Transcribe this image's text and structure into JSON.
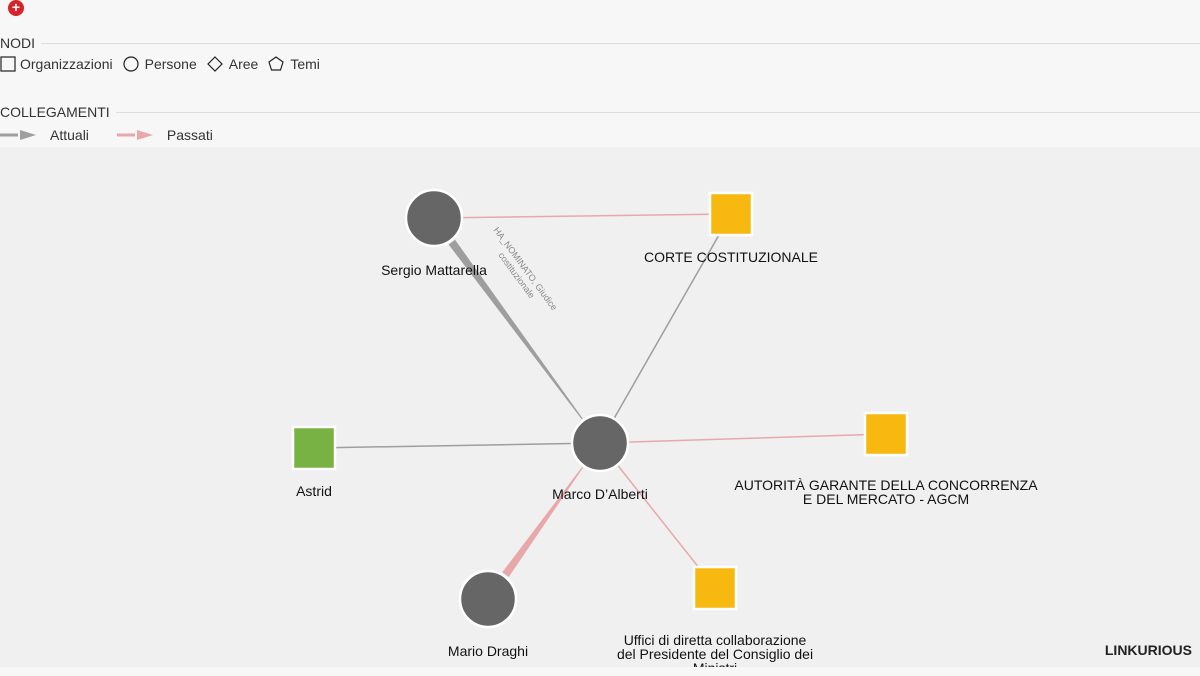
{
  "toolbar": {
    "add_icon": "plus-circle-icon",
    "add_glyph": "+"
  },
  "legend": {
    "nodes_title": "NODI",
    "node_types": [
      {
        "label": "Organizzazioni",
        "icon": "square-icon"
      },
      {
        "label": "Persone",
        "icon": "circle-icon"
      },
      {
        "label": "Aree",
        "icon": "diamond-icon"
      },
      {
        "label": "Temi",
        "icon": "pentagon-icon"
      }
    ],
    "links_title": "COLLEGAMENTI",
    "link_types": [
      {
        "label": "Attuali",
        "color": "#9e9e9e"
      },
      {
        "label": "Passati",
        "color": "#e8a8aa"
      }
    ]
  },
  "colors": {
    "person": "#666666",
    "org_yellow": "#f7b90f",
    "org_green": "#77b243",
    "current_edge": "#9e9e9e",
    "past_edge": "#e8a8aa"
  },
  "graph": {
    "nodes": [
      {
        "id": "mattarella",
        "shape": "circle",
        "color": "person",
        "label_lines": [
          "Sergio Mattarella"
        ]
      },
      {
        "id": "corte",
        "shape": "square",
        "color": "org_yellow",
        "label_lines": [
          "CORTE COSTITUZIONALE"
        ]
      },
      {
        "id": "astrid",
        "shape": "square",
        "color": "org_green",
        "label_lines": [
          "Astrid"
        ]
      },
      {
        "id": "dalberti",
        "shape": "circle",
        "color": "person",
        "label_lines": [
          "Marco D’Alberti"
        ]
      },
      {
        "id": "agcm",
        "shape": "square",
        "color": "org_yellow",
        "label_lines": [
          "AUTORITÀ GARANTE DELLA CONCORRENZA",
          "E DEL MERCATO - AGCM"
        ]
      },
      {
        "id": "draghi",
        "shape": "circle",
        "color": "person",
        "label_lines": [
          "Mario Draghi"
        ]
      },
      {
        "id": "uffici",
        "shape": "square",
        "color": "org_yellow",
        "label_lines": [
          "Uffici di diretta collaborazione",
          "del Presidente del Consiglio dei",
          "Ministri"
        ]
      }
    ],
    "edges": [
      {
        "from": "mattarella",
        "to": "corte",
        "type": "past"
      },
      {
        "from": "corte",
        "to": "dalberti",
        "type": "current"
      },
      {
        "from": "astrid",
        "to": "dalberti",
        "type": "current"
      },
      {
        "from": "dalberti",
        "to": "agcm",
        "type": "past"
      },
      {
        "from": "dalberti",
        "to": "uffici",
        "type": "past"
      },
      {
        "from": "mattarella",
        "to": "dalberti",
        "type": "current",
        "thick": true,
        "label_lines": [
          "HA_NOMINATO, Giudice",
          "costituzionale"
        ]
      },
      {
        "from": "draghi",
        "to": "dalberti",
        "type": "past",
        "thick": true
      }
    ]
  },
  "brand": {
    "logo_text": "LINKURIOUS"
  }
}
